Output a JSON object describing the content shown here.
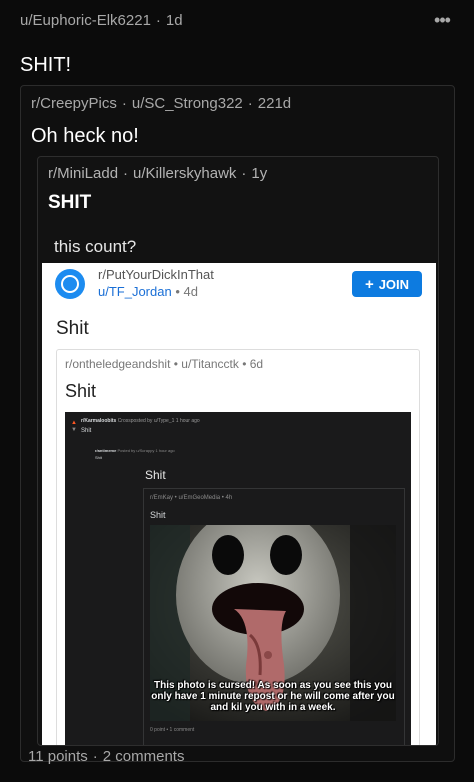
{
  "post": {
    "username": "u/Euphoric-Elk6221",
    "age": "1d",
    "title": "SHIT!",
    "points": "11 points",
    "comments": "2 comments"
  },
  "crosspost1": {
    "subreddit": "r/CreepyPics",
    "username": "u/SC_Strong322",
    "age": "221d",
    "title": "Oh heck no!"
  },
  "crosspost2": {
    "subreddit": "r/MiniLadd",
    "username": "u/Killerskyhawk",
    "age": "1y",
    "title": "SHIT",
    "body": "this count?"
  },
  "screenshot": {
    "subreddit": "r/PutYourDickInThat",
    "username": "u/TF_Jordan",
    "age": "4d",
    "join_label": "JOIN",
    "title": "Shit",
    "inner": {
      "subreddit": "r/ontheledgeandshit",
      "username": "u/Titancctk",
      "age": "6d",
      "title": "Shit"
    },
    "dark": {
      "line1_sub": "r/Karmaloobits",
      "line1_rest": "Crossposted by u/Type_1",
      "line1_age": "1 hour ago",
      "title1": "Shit",
      "line2_sub": "r/antimeme",
      "line2_rest": "Posted by u/Scrappy",
      "line2_age": "1 hour ago",
      "title2": "Shit",
      "big_title": "Shit",
      "meta3": "r/EmKay • u/EmGeoMedia • 4h",
      "title3": "Shit",
      "caption": "This photo is cursed! As soon as you see this you only have 1 minute repost or he will come after you and kil you with in a week.",
      "comments": "0 point • 1 comment"
    }
  },
  "icons": {
    "more": "more-horizontal-icon",
    "community": "community-planet-icon",
    "join": "plus-icon"
  },
  "colors": {
    "background": "#0b0b0b",
    "join_blue": "#0d7be0",
    "avatar_blue": "#1d8cf0",
    "username_blue": "#1a6fd6"
  }
}
